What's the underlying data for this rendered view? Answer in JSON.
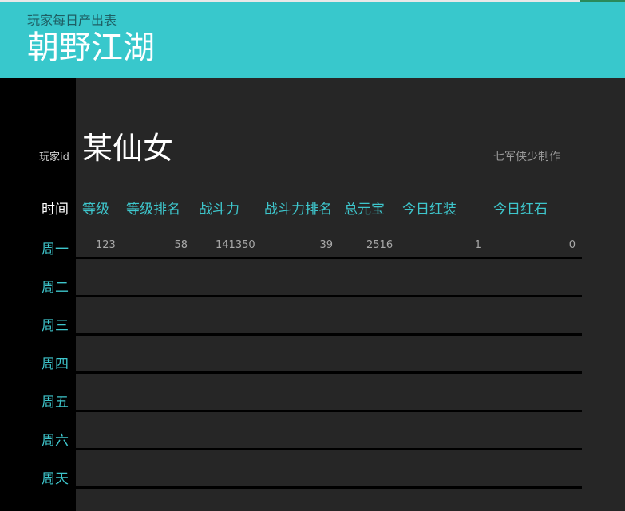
{
  "header": {
    "subtitle": "玩家每日产出表",
    "title": "朝野江湖"
  },
  "player": {
    "id_label": "玩家id",
    "name": "某仙女",
    "credit": "七军侠少制作"
  },
  "table": {
    "time_header": "时间",
    "columns": [
      "等级",
      "等级排名",
      "战斗力",
      "战斗力排名",
      "总元宝",
      "今日红装",
      "今日红石"
    ],
    "rows": [
      {
        "day": "周一",
        "values": [
          "123",
          "58",
          "141350",
          "39",
          "2516",
          "1",
          "0"
        ]
      },
      {
        "day": "周二",
        "values": []
      },
      {
        "day": "周三",
        "values": []
      },
      {
        "day": "周四",
        "values": []
      },
      {
        "day": "周五",
        "values": []
      },
      {
        "day": "周六",
        "values": []
      },
      {
        "day": "周天",
        "values": []
      }
    ]
  },
  "colors": {
    "accent": "#38c8cc",
    "accent_text": "#3ec6cc",
    "panel": "#262626",
    "background": "#000000"
  }
}
